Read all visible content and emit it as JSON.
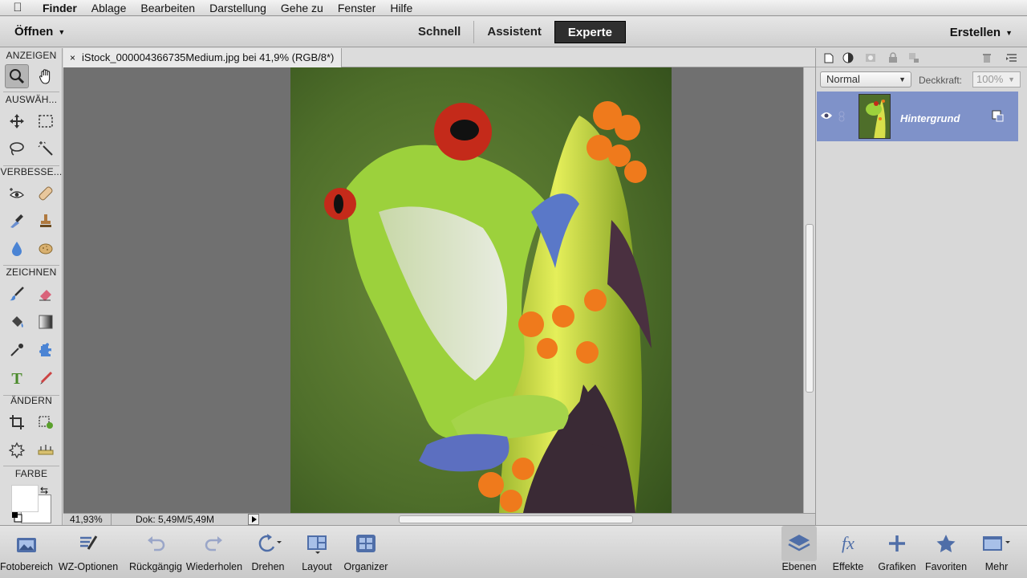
{
  "menubar": {
    "app": "Finder",
    "items": [
      "Ablage",
      "Bearbeiten",
      "Darstellung",
      "Gehe zu",
      "Fenster",
      "Hilfe"
    ]
  },
  "modebar": {
    "open_label": "Öffnen",
    "modes": [
      "Schnell",
      "Assistent",
      "Experte"
    ],
    "active_mode": "Experte",
    "create_label": "Erstellen"
  },
  "tools": {
    "sections": [
      "ANZEIGEN",
      "AUSWÄH...",
      "VERBESSE...",
      "ZEICHNEN",
      "ÄNDERN",
      "FARBE"
    ]
  },
  "document": {
    "tab_title": "iStock_000004366735Medium.jpg bei 41,9% (RGB/8*)",
    "zoom": "41,93%",
    "doc_size": "Dok: 5,49M/5,49M"
  },
  "layers": {
    "blend_mode": "Normal",
    "opacity_label": "Deckkraft:",
    "opacity_value": "100%",
    "layer_name": "Hintergrund"
  },
  "bottombar": {
    "left": [
      "Fotobereich",
      "WZ-Optionen",
      "Rückgängig",
      "Wiederholen",
      "Drehen",
      "Layout",
      "Organizer"
    ],
    "right": [
      "Ebenen",
      "Effekte",
      "Grafiken",
      "Favoriten",
      "Mehr"
    ]
  },
  "colors": {
    "active_mode_bg": "#2f2f2f",
    "layer_selected": "#7f92c9",
    "canvas_bg": "#707070"
  }
}
